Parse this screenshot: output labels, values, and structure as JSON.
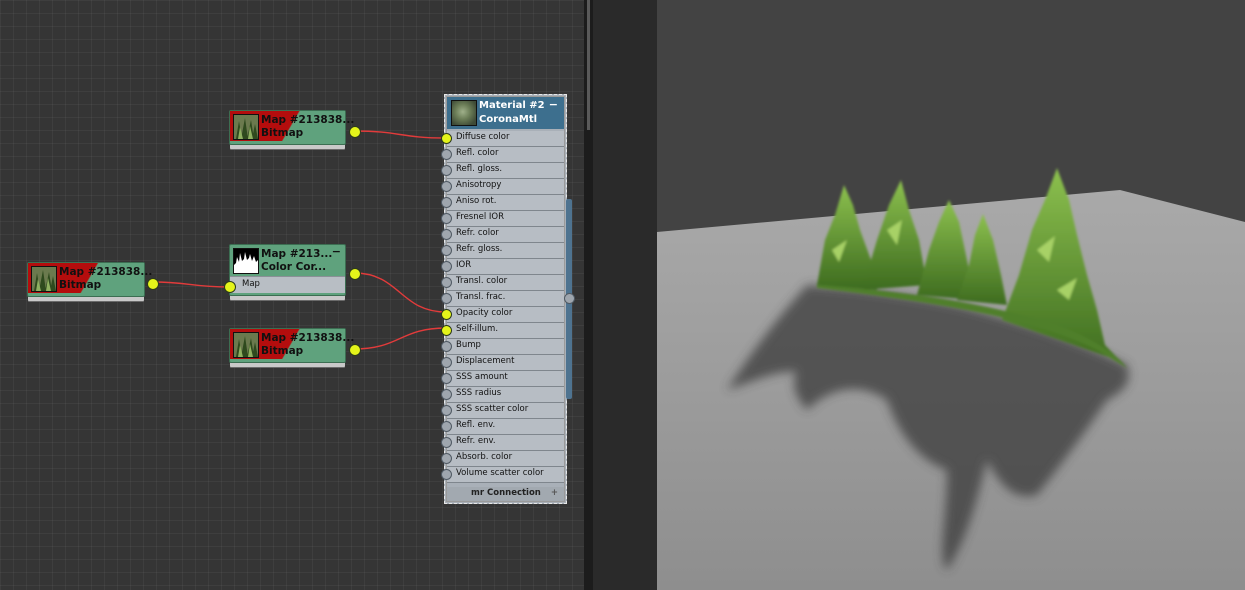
{
  "colors": {
    "node_green": "#5fa27d",
    "node_error_red": "#b40d0d",
    "material_header": "#3d6f8e",
    "wire": "#e23b3b",
    "socket_connected": "#e4f41a",
    "socket_empty": "#9fa6ae"
  },
  "nodes": {
    "map_a": {
      "title": "Map #213838...",
      "subtitle": "Bitmap",
      "icon": "tree-thumbnail-icon"
    },
    "map_b": {
      "title": "Map #213838...",
      "subtitle": "Bitmap",
      "icon": "tree-thumbnail-icon"
    },
    "color_correct": {
      "title": "Map #213...",
      "subtitle": "Color Cor...",
      "slot": "Map",
      "collapse": "−",
      "icon": "alpha-mask-thumbnail-icon"
    },
    "map_c": {
      "title": "Map #213838...",
      "subtitle": "Bitmap",
      "icon": "tree-thumbnail-icon"
    }
  },
  "material": {
    "title": "Material #2",
    "subtitle": "CoronaMtl",
    "collapse": "−",
    "icon": "material-sphere-icon",
    "slots": [
      {
        "label": "Diffuse color",
        "connected": true
      },
      {
        "label": "Refl. color",
        "connected": false
      },
      {
        "label": "Refl. gloss.",
        "connected": false
      },
      {
        "label": "Anisotropy",
        "connected": false
      },
      {
        "label": "Aniso rot.",
        "connected": false
      },
      {
        "label": "Fresnel IOR",
        "connected": false
      },
      {
        "label": "Refr. color",
        "connected": false
      },
      {
        "label": "Refr. gloss.",
        "connected": false
      },
      {
        "label": "IOR",
        "connected": false
      },
      {
        "label": "Transl. color",
        "connected": false
      },
      {
        "label": "Transl. frac.",
        "connected": false
      },
      {
        "label": "Opacity color",
        "connected": true
      },
      {
        "label": "Self-illum.",
        "connected": true
      },
      {
        "label": "Bump",
        "connected": false
      },
      {
        "label": "Displacement",
        "connected": false
      },
      {
        "label": "SSS amount",
        "connected": false
      },
      {
        "label": "SSS radius",
        "connected": false
      },
      {
        "label": "SSS scatter color",
        "connected": false
      },
      {
        "label": "Refl. env.",
        "connected": false
      },
      {
        "label": "Refr. env.",
        "connected": false
      },
      {
        "label": "Absorb. color",
        "connected": false
      },
      {
        "label": "Volume scatter color",
        "connected": false
      }
    ],
    "footer": "mr Connection",
    "footer_plus": "+"
  },
  "viewport": {
    "content": "rendered-tree-billboards-with-shadow"
  }
}
